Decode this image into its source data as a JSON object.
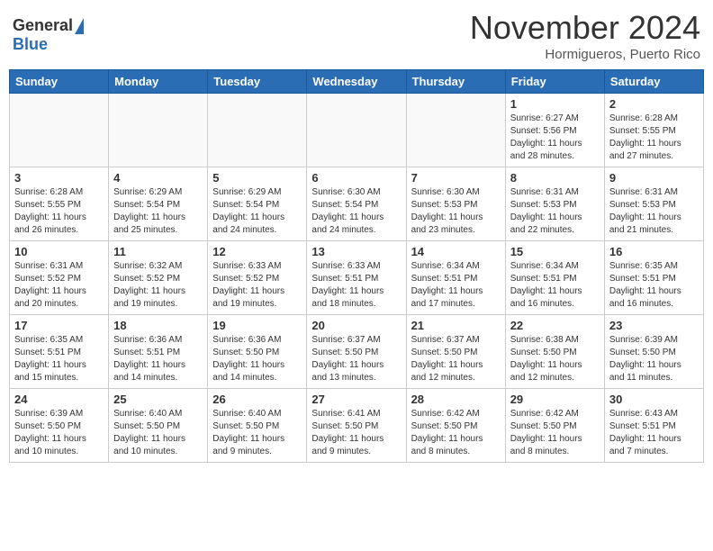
{
  "header": {
    "logo_general": "General",
    "logo_blue": "Blue",
    "month_title": "November 2024",
    "location": "Hormigueros, Puerto Rico"
  },
  "days_of_week": [
    "Sunday",
    "Monday",
    "Tuesday",
    "Wednesday",
    "Thursday",
    "Friday",
    "Saturday"
  ],
  "weeks": [
    [
      {
        "day": "",
        "info": ""
      },
      {
        "day": "",
        "info": ""
      },
      {
        "day": "",
        "info": ""
      },
      {
        "day": "",
        "info": ""
      },
      {
        "day": "",
        "info": ""
      },
      {
        "day": "1",
        "info": "Sunrise: 6:27 AM\nSunset: 5:56 PM\nDaylight: 11 hours\nand 28 minutes."
      },
      {
        "day": "2",
        "info": "Sunrise: 6:28 AM\nSunset: 5:55 PM\nDaylight: 11 hours\nand 27 minutes."
      }
    ],
    [
      {
        "day": "3",
        "info": "Sunrise: 6:28 AM\nSunset: 5:55 PM\nDaylight: 11 hours\nand 26 minutes."
      },
      {
        "day": "4",
        "info": "Sunrise: 6:29 AM\nSunset: 5:54 PM\nDaylight: 11 hours\nand 25 minutes."
      },
      {
        "day": "5",
        "info": "Sunrise: 6:29 AM\nSunset: 5:54 PM\nDaylight: 11 hours\nand 24 minutes."
      },
      {
        "day": "6",
        "info": "Sunrise: 6:30 AM\nSunset: 5:54 PM\nDaylight: 11 hours\nand 24 minutes."
      },
      {
        "day": "7",
        "info": "Sunrise: 6:30 AM\nSunset: 5:53 PM\nDaylight: 11 hours\nand 23 minutes."
      },
      {
        "day": "8",
        "info": "Sunrise: 6:31 AM\nSunset: 5:53 PM\nDaylight: 11 hours\nand 22 minutes."
      },
      {
        "day": "9",
        "info": "Sunrise: 6:31 AM\nSunset: 5:53 PM\nDaylight: 11 hours\nand 21 minutes."
      }
    ],
    [
      {
        "day": "10",
        "info": "Sunrise: 6:31 AM\nSunset: 5:52 PM\nDaylight: 11 hours\nand 20 minutes."
      },
      {
        "day": "11",
        "info": "Sunrise: 6:32 AM\nSunset: 5:52 PM\nDaylight: 11 hours\nand 19 minutes."
      },
      {
        "day": "12",
        "info": "Sunrise: 6:33 AM\nSunset: 5:52 PM\nDaylight: 11 hours\nand 19 minutes."
      },
      {
        "day": "13",
        "info": "Sunrise: 6:33 AM\nSunset: 5:51 PM\nDaylight: 11 hours\nand 18 minutes."
      },
      {
        "day": "14",
        "info": "Sunrise: 6:34 AM\nSunset: 5:51 PM\nDaylight: 11 hours\nand 17 minutes."
      },
      {
        "day": "15",
        "info": "Sunrise: 6:34 AM\nSunset: 5:51 PM\nDaylight: 11 hours\nand 16 minutes."
      },
      {
        "day": "16",
        "info": "Sunrise: 6:35 AM\nSunset: 5:51 PM\nDaylight: 11 hours\nand 16 minutes."
      }
    ],
    [
      {
        "day": "17",
        "info": "Sunrise: 6:35 AM\nSunset: 5:51 PM\nDaylight: 11 hours\nand 15 minutes."
      },
      {
        "day": "18",
        "info": "Sunrise: 6:36 AM\nSunset: 5:51 PM\nDaylight: 11 hours\nand 14 minutes."
      },
      {
        "day": "19",
        "info": "Sunrise: 6:36 AM\nSunset: 5:50 PM\nDaylight: 11 hours\nand 14 minutes."
      },
      {
        "day": "20",
        "info": "Sunrise: 6:37 AM\nSunset: 5:50 PM\nDaylight: 11 hours\nand 13 minutes."
      },
      {
        "day": "21",
        "info": "Sunrise: 6:37 AM\nSunset: 5:50 PM\nDaylight: 11 hours\nand 12 minutes."
      },
      {
        "day": "22",
        "info": "Sunrise: 6:38 AM\nSunset: 5:50 PM\nDaylight: 11 hours\nand 12 minutes."
      },
      {
        "day": "23",
        "info": "Sunrise: 6:39 AM\nSunset: 5:50 PM\nDaylight: 11 hours\nand 11 minutes."
      }
    ],
    [
      {
        "day": "24",
        "info": "Sunrise: 6:39 AM\nSunset: 5:50 PM\nDaylight: 11 hours\nand 10 minutes."
      },
      {
        "day": "25",
        "info": "Sunrise: 6:40 AM\nSunset: 5:50 PM\nDaylight: 11 hours\nand 10 minutes."
      },
      {
        "day": "26",
        "info": "Sunrise: 6:40 AM\nSunset: 5:50 PM\nDaylight: 11 hours\nand 9 minutes."
      },
      {
        "day": "27",
        "info": "Sunrise: 6:41 AM\nSunset: 5:50 PM\nDaylight: 11 hours\nand 9 minutes."
      },
      {
        "day": "28",
        "info": "Sunrise: 6:42 AM\nSunset: 5:50 PM\nDaylight: 11 hours\nand 8 minutes."
      },
      {
        "day": "29",
        "info": "Sunrise: 6:42 AM\nSunset: 5:50 PM\nDaylight: 11 hours\nand 8 minutes."
      },
      {
        "day": "30",
        "info": "Sunrise: 6:43 AM\nSunset: 5:51 PM\nDaylight: 11 hours\nand 7 minutes."
      }
    ]
  ]
}
